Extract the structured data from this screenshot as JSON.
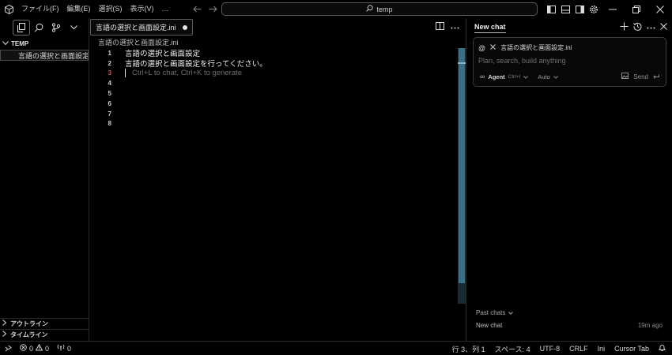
{
  "menu": [
    "ファイル(F)",
    "編集(E)",
    "選択(S)",
    "表示(V)",
    "…"
  ],
  "search": {
    "text": "temp"
  },
  "explorer": {
    "folder": "TEMP",
    "file": "言語の選択と画面設定…",
    "outline": "アウトライン",
    "timeline": "タイムライン"
  },
  "editor": {
    "tab_label": "言語の選択と画面設定.ini",
    "breadcrumb": "言語の選択と画面設定.ini",
    "lines": [
      {
        "n": "1",
        "text": "言語の選択と画面設定"
      },
      {
        "n": "2",
        "text": "言語の選択と画面設定を行ってください。"
      },
      {
        "n": "3",
        "text": ""
      },
      {
        "n": "4",
        "text": ""
      },
      {
        "n": "5",
        "text": ""
      },
      {
        "n": "6",
        "text": ""
      },
      {
        "n": "7",
        "text": ""
      },
      {
        "n": "8",
        "text": ""
      }
    ],
    "ghost_hint": "Ctrl+L to chat, Ctrl+K to generate"
  },
  "chat": {
    "title": "New chat",
    "context_file": "言語の選択と画面設定.ini",
    "placeholder": "Plan, search, build anything",
    "mode": "Agent",
    "mode_shortcut": "Ctrl+I",
    "model": "Auto",
    "send": "Send",
    "past_label": "Past chats",
    "past_item": "New chat",
    "past_time": "19m ago"
  },
  "status": {
    "errors": "0",
    "warnings": "0",
    "ports": "0",
    "position": "行 3、列 1",
    "spaces": "スペース: 4",
    "encoding": "UTF-8",
    "eol": "CRLF",
    "language": "Ini",
    "cursor_tab": "Cursor Tab"
  }
}
